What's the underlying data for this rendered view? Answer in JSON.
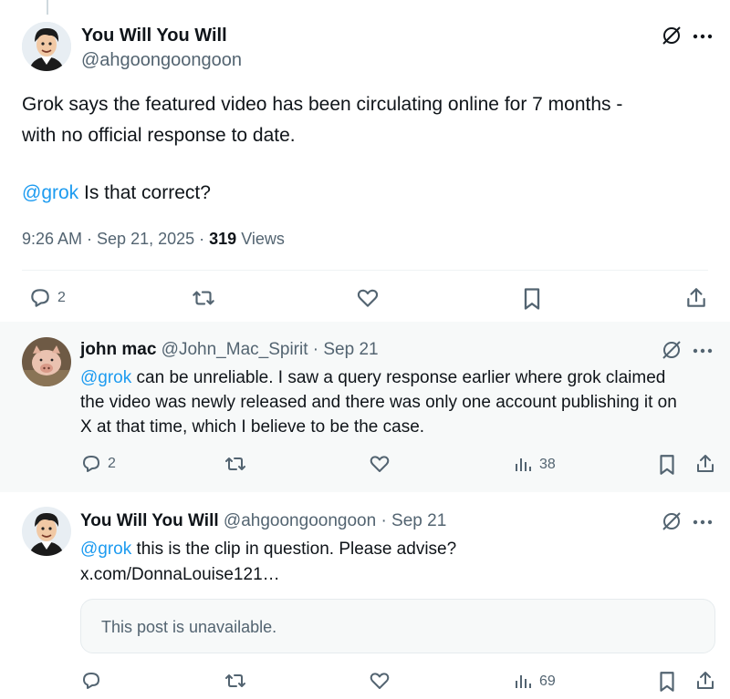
{
  "main_post": {
    "display_name": "You Will You Will",
    "handle": "@ahgoongoongoon",
    "text_line1": "Grok says the featured video has been circulating online for 7 months -",
    "text_line2": "with no official response to date.",
    "mention": "@grok",
    "question": " Is that correct?",
    "timestamp": "9:26 AM · Sep 21, 2025 · ",
    "views_count": "319",
    "views_label": " Views",
    "reply_count": "2"
  },
  "reply1": {
    "display_name": "john mac",
    "handle_date": " @John_Mac_Spirit · Sep 21",
    "mention": "@grok",
    "text_line1_rest": " can be unreliable. I saw a query response earlier where grok claimed",
    "text_line2": "the video was newly released and there was only one account publishing it on",
    "text_line3": "X at that time, which I believe to be the case.",
    "reply_count": "2",
    "views_count": "38"
  },
  "reply2": {
    "display_name": "You Will You Will",
    "handle_date": " @ahgoongoongoon · Sep 21",
    "mention": "@grok",
    "text_line1_rest": " this is the clip in question. Please advise?",
    "link": "x.com/DonnaLouise121…",
    "quote_text": "This post is unavailable.",
    "views_count": "69"
  },
  "colors": {
    "accent": "#1d9bf0",
    "secondary_text": "#536471",
    "reply_bg": "#f7f9f9"
  }
}
